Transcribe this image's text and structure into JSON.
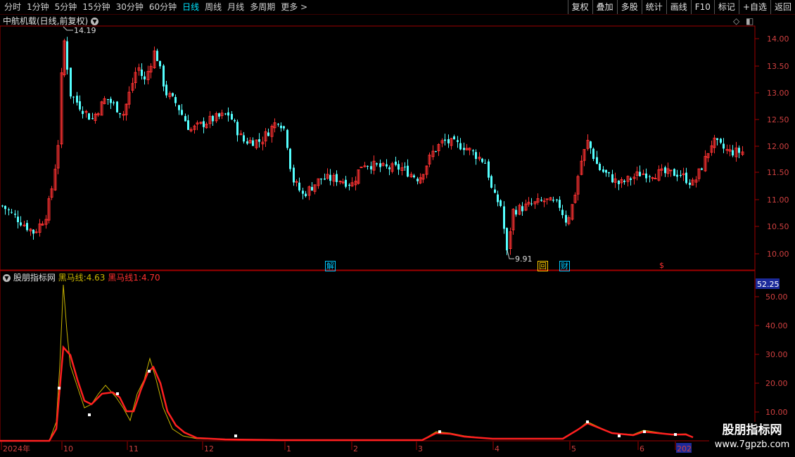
{
  "toolbar": {
    "periods": [
      "分时",
      "1分钟",
      "5分钟",
      "15分钟",
      "30分钟",
      "60分钟",
      "日线",
      "周线",
      "月线",
      "多周期",
      "更多 >"
    ],
    "active_period": "日线",
    "actions": [
      "复权",
      "叠加",
      "多股",
      "统计",
      "画线",
      "F10",
      "标记",
      "+自选",
      "返回"
    ]
  },
  "main_chart": {
    "title": "中航机载(日线,前复权)",
    "high_label": "14.19",
    "low_label": "9.91",
    "y_ticks": [
      "14.00",
      "13.50",
      "13.00",
      "12.50",
      "12.00",
      "11.50",
      "11.00",
      "10.50",
      "10.00"
    ],
    "markers": [
      {
        "text": "解",
        "color": "#00c8ff"
      },
      {
        "text": "回",
        "color": "#ffcc00"
      },
      {
        "text": "财",
        "color": "#00c8ff"
      },
      {
        "text": "$",
        "color": "#ff3030"
      }
    ],
    "colors": {
      "up": "#ff3232",
      "down": "#54ffff",
      "frame": "#a00000"
    }
  },
  "indicator": {
    "name": "股朋指标网",
    "line1_label": "黑马线:",
    "line1_value": "4.63",
    "line2_label": "黑马线1:",
    "line2_value": "4.70",
    "current_value": "52.25",
    "y_ticks": [
      "50.00",
      "40.00",
      "30.00",
      "20.00",
      "10.00"
    ],
    "colors": {
      "line1": "#c8b400",
      "line2": "#ff2020"
    }
  },
  "x_axis": {
    "labels": [
      "2024年",
      "10",
      "11",
      "12",
      "1",
      "2",
      "3",
      "4",
      "5",
      "6",
      "202"
    ]
  },
  "watermark": {
    "title": "股朋指标网",
    "url": "www.7gpzb.com"
  }
}
